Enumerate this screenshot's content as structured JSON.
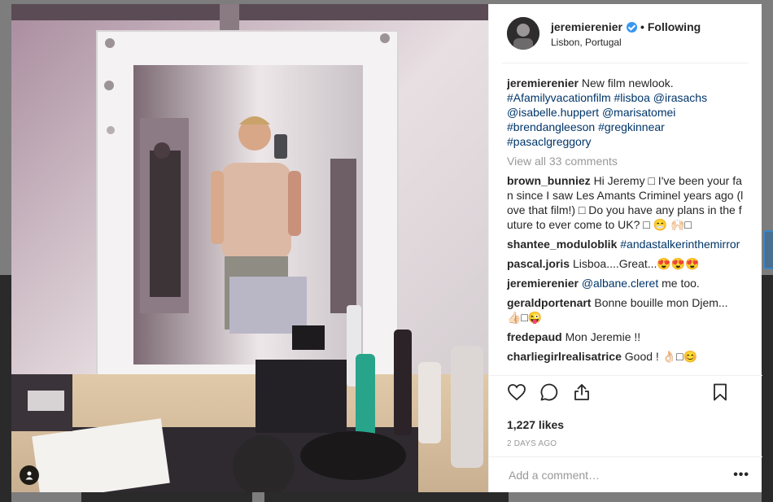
{
  "post": {
    "username": "jeremierenier",
    "follow_label": "Following",
    "dot": "•",
    "location": "Lisbon, Portugal",
    "caption_text": " New film newlook.",
    "caption_tags": "#Afamilyvacationfilm #lisboa @irasachs @isabelle.huppert @marisatomei #brendangleeson #gregkinnear #pasaclgreggory",
    "view_all": "View all 33 comments",
    "likes": "1,227 likes",
    "date": "2 DAYS AGO",
    "add_comment_placeholder": "Add a comment…",
    "more_label": "•••"
  },
  "comments": [
    {
      "user": "brown_bunniez",
      "text": "Hi Jeremy □ I've been your fan since I saw Les Amants Criminel years ago (love that film!) □ Do you have any plans in the future to ever come to UK? □ 😁 🙌🏻□",
      "is_tag": false
    },
    {
      "user": "shantee_moduloblik",
      "text": "#andastalkerinthemirror",
      "is_tag": true
    },
    {
      "user": "pascal.joris",
      "text": "Lisboa....Great...😍😍😍",
      "is_tag": false
    },
    {
      "user": "jeremierenier",
      "text": "@albane.cleret",
      "suffix": " me too.",
      "is_tag": true
    },
    {
      "user": "geraldportenart",
      "text": "Bonne bouille mon Djem... 👍🏻□😜",
      "is_tag": false
    },
    {
      "user": "fredepaud",
      "text": "Mon Jeremie !!",
      "is_tag": false
    },
    {
      "user": "charliegirlrealisatrice",
      "text": "Good ! 👌🏻□😊",
      "is_tag": false
    }
  ],
  "icons": {
    "like": "heart-icon",
    "comment": "speech-bubble-icon",
    "share": "share-icon",
    "save": "bookmark-icon",
    "tag": "user-tag-icon",
    "verified": "verified-badge-icon"
  },
  "colors": {
    "link": "#003569",
    "verified": "#3897f0",
    "muted": "#999999",
    "text": "#262626"
  }
}
